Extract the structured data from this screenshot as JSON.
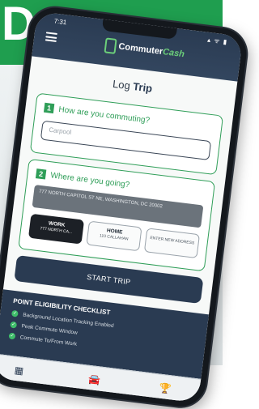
{
  "banner": {
    "letter": "D",
    "color": "#1f9e4f"
  },
  "status": {
    "time": "7:31",
    "icons": "signal wifi battery",
    "icons_text": "▴ ᯤ ▮"
  },
  "header": {
    "menu_icon": "hamburger-menu-icon",
    "logo_part1": "Commuter",
    "logo_part2": "Cash"
  },
  "page": {
    "title_part1": "Log ",
    "title_part2": "Trip"
  },
  "step1": {
    "number": "1",
    "question": "How are you commuting?",
    "input_placeholder": "Carpool"
  },
  "step2": {
    "number": "2",
    "question": "Where are you going?",
    "address": "777 NORTH CAPITOL ST NE, WASHINGTON, DC 20002",
    "options": [
      {
        "label": "WORK",
        "sub": "777 NORTH CA...",
        "active": true
      },
      {
        "label": "HOME",
        "sub": "110 CALLAHAN",
        "active": false
      },
      {
        "label": "ENTER NEW ADDRESS",
        "sub": "",
        "active": false
      }
    ]
  },
  "start_button": "START TRIP",
  "checklist": {
    "title": "POINT ELIGIBILITY CHECKLIST",
    "items": [
      "Background Location Tracking Enabled",
      "Peak Commute Window",
      "Commute To/From Work"
    ]
  },
  "tabs": [
    {
      "icon": "calendar-icon",
      "glyph": "▦"
    },
    {
      "icon": "car-icon",
      "glyph": "🚘"
    },
    {
      "icon": "trophy-icon",
      "glyph": "🏆"
    }
  ],
  "colors": {
    "accent_green": "#2f9e58",
    "navy": "#2a3b52"
  }
}
